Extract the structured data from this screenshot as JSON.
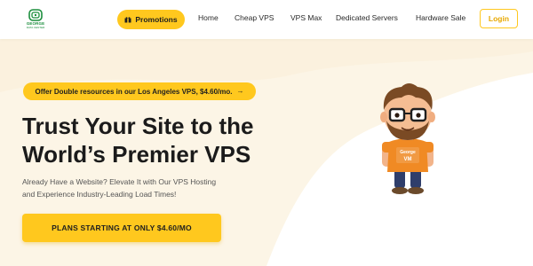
{
  "header": {
    "logo_text": "GEORGE",
    "logo_subtext": "DATA CENTER",
    "promotions_label": "Promotions",
    "nav": [
      "Home",
      "Cheap VPS",
      "VPS Max",
      "Dedicated Servers",
      "Hardware Sale"
    ],
    "login_label": "Login"
  },
  "hero": {
    "offer_text": "Offer Double resources in our Los Angeles VPS, $4.60/mo.",
    "offer_arrow": "→",
    "title_line1": "Trust Your Site to the",
    "title_line2": "World’s Premier VPS",
    "subtitle_line1": "Already Have a Website? Elevate It with Our VPS Hosting",
    "subtitle_line2": "and Experience Industry-Leading Load Times!",
    "cta_label": "PLANS STARTING AT ONLY $4.60/MO",
    "mascot_shirt_line1": "George",
    "mascot_shirt_line2": "VM"
  },
  "colors": {
    "accent": "#ffc81e",
    "brand_green": "#1c8e3d",
    "hero_background": "#fcf5e6",
    "text_dark": "#1b1b1b"
  },
  "icons": {
    "promotions": "gift-icon",
    "offer": "arrow-right-icon",
    "logo": "logo-mark-icon"
  }
}
